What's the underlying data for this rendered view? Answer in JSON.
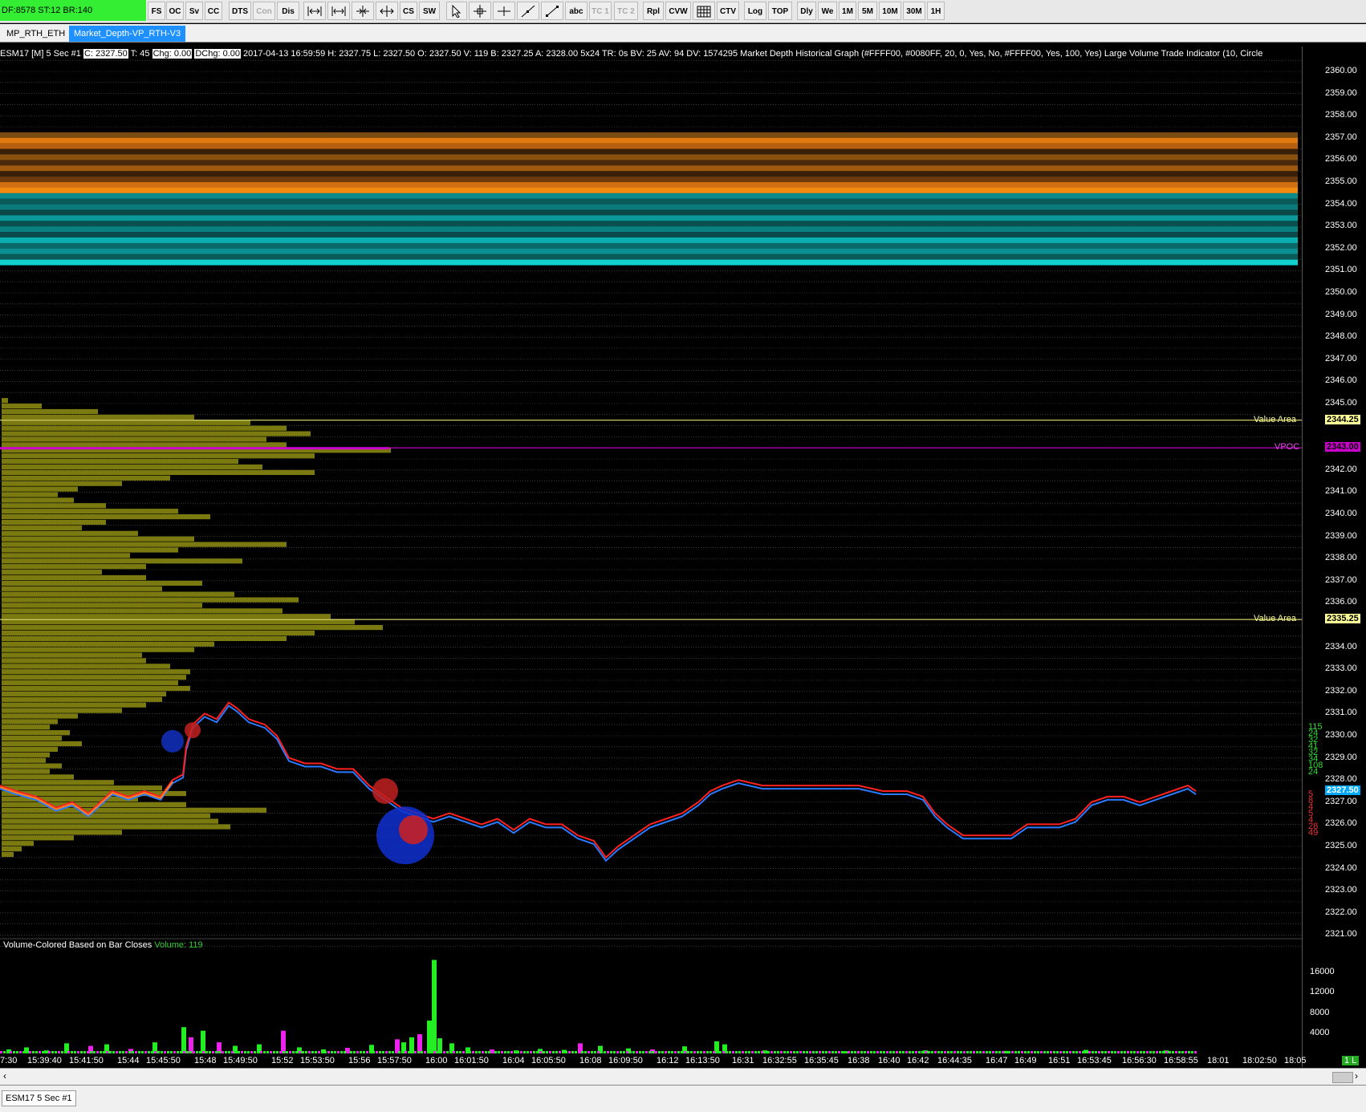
{
  "toolbar": {
    "status": "DF:8578  ST:12  BR:140",
    "buttons": [
      "FS",
      "OC",
      "Sv",
      "CC",
      "DTS",
      "Con",
      "Dis",
      "CS",
      "SW",
      "abc",
      "TC 1",
      "TC 2",
      "Rpl",
      "CVW",
      "CTV",
      "Log",
      "TOP",
      "Dly",
      "We",
      "1M",
      "5M",
      "10M",
      "30M",
      "1H"
    ]
  },
  "tabs": [
    "MP_RTH_ETH",
    "Market_Depth-VP_RTH-V3"
  ],
  "header": {
    "symbol": "ESM17 [M]  5 Sec  #1",
    "close": "C: 2327.50",
    "ticks": "T: 45",
    "chg": "Chg: 0.00",
    "dchg": "DChg: 0.00",
    "details": "2017-04-13 16:59:59 H: 2327.75  L: 2327.50  O: 2327.50  V: 119  B: 2327.25  A: 2328.00  5x24  TR: 0s  BV: 25  AV: 94  DV: 1574295  Market Depth Historical Graph   (#FFFF00, #0080FF, 20, 0, Yes, No, #FFFF00, Yes, 100, Yes)   Large Volume Trade Indicator   (10, Circle"
  },
  "price_axis": {
    "ticks": [
      "2360.00",
      "2359.00",
      "2358.00",
      "2357.00",
      "2356.00",
      "2355.00",
      "2354.00",
      "2353.00",
      "2352.00",
      "2351.00",
      "2350.00",
      "2349.00",
      "2348.00",
      "2347.00",
      "2346.00",
      "2345.00",
      "2342.00",
      "2341.00",
      "2340.00",
      "2339.00",
      "2338.00",
      "2337.00",
      "2336.00",
      "2334.00",
      "2333.00",
      "2332.00",
      "2331.00",
      "2330.00",
      "2329.00",
      "2328.00",
      "2327.00",
      "2326.00",
      "2325.00",
      "2324.00",
      "2323.00",
      "2322.00",
      "2321.00"
    ],
    "value_area_high": "2344.25",
    "vpoc": "2343.00",
    "value_area_low": "2335.25",
    "last_price": "2327.50"
  },
  "overlays": {
    "value_area_label": "Value Area",
    "vpoc_label": "VPOC",
    "ask_depth": [
      "115",
      "24",
      "32",
      "41",
      "32",
      "34",
      "108",
      "24"
    ],
    "bid_depth": [
      "5",
      "8",
      "4",
      "5",
      "4",
      "28",
      "49"
    ]
  },
  "volume_pane": {
    "title": "Volume-Colored Based on Bar Closes",
    "value": "Volume: 119",
    "ticks": [
      "16000",
      "12000",
      "8000",
      "4000"
    ]
  },
  "time_axis": [
    "7:30",
    "15:39:40",
    "15:41:50",
    "15:44",
    "15:45:50",
    "15:48",
    "15:49:50",
    "15:52",
    "15:53:50",
    "15:56",
    "15:57:50",
    "16:00",
    "16:01:50",
    "16:04",
    "16:05:50",
    "16:08",
    "16:09:50",
    "16:12",
    "16:13:50",
    "16:31",
    "16:32:55",
    "16:35:45",
    "16:38",
    "16:40",
    "16:42",
    "16:44:35",
    "16:47",
    "16:49",
    "16:51",
    "16:53:45",
    "16:56:30",
    "16:58:55",
    "18:01",
    "18:02:50",
    "18:05"
  ],
  "bottom_tab": "ESM17  5 Sec  #1",
  "corner_badge": "1 L",
  "colors": {
    "bid_line": "#ff2020",
    "ask_line": "#2a7aff",
    "profile": "#7a7a10",
    "vpoc": "#cc00cc",
    "value_area": "#ffff80",
    "volume_up": "#22ee22",
    "volume_down": "#ee22ee"
  }
}
